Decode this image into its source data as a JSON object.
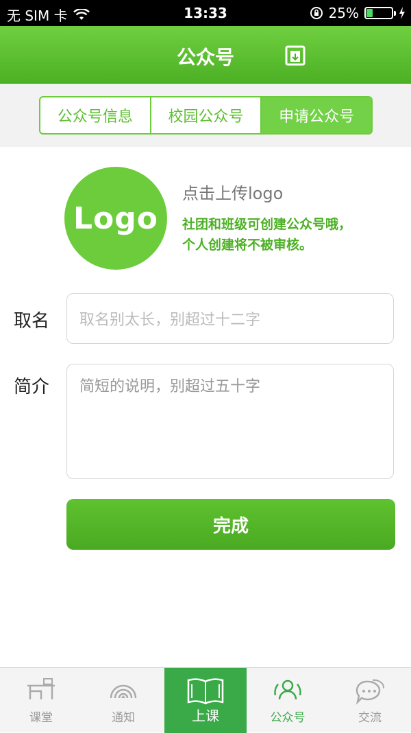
{
  "status_bar": {
    "carrier": "无 SIM 卡",
    "time": "13:33",
    "battery": "25%",
    "battery_level": 0.25
  },
  "nav": {
    "title": "公众号",
    "icon": "export-doc-icon"
  },
  "segments": [
    {
      "label": "公众号信息",
      "active": false
    },
    {
      "label": "校园公众号",
      "active": false
    },
    {
      "label": "申请公众号",
      "active": true
    }
  ],
  "logo_upload": {
    "logo_text": "Logo",
    "title": "点击上传logo",
    "desc_line1": "社团和班级可创建公众号哦，",
    "desc_line2": "个人创建将不被审核。"
  },
  "form": {
    "name_label": "取名",
    "name_placeholder": "取名别太长，别超过十二字",
    "desc_label": "简介",
    "desc_placeholder": "简短的说明，别超过五十字",
    "submit": "完成"
  },
  "tabs": [
    {
      "label": "课堂",
      "icon": "desk-icon"
    },
    {
      "label": "通知",
      "icon": "broadcast-icon"
    },
    {
      "label": "上课",
      "icon": "book-icon"
    },
    {
      "label": "公众号",
      "icon": "group-icon"
    },
    {
      "label": "交流",
      "icon": "chat-icon"
    }
  ],
  "colors": {
    "accent": "#5cbf2e",
    "tab_active": "#3aaa48"
  }
}
